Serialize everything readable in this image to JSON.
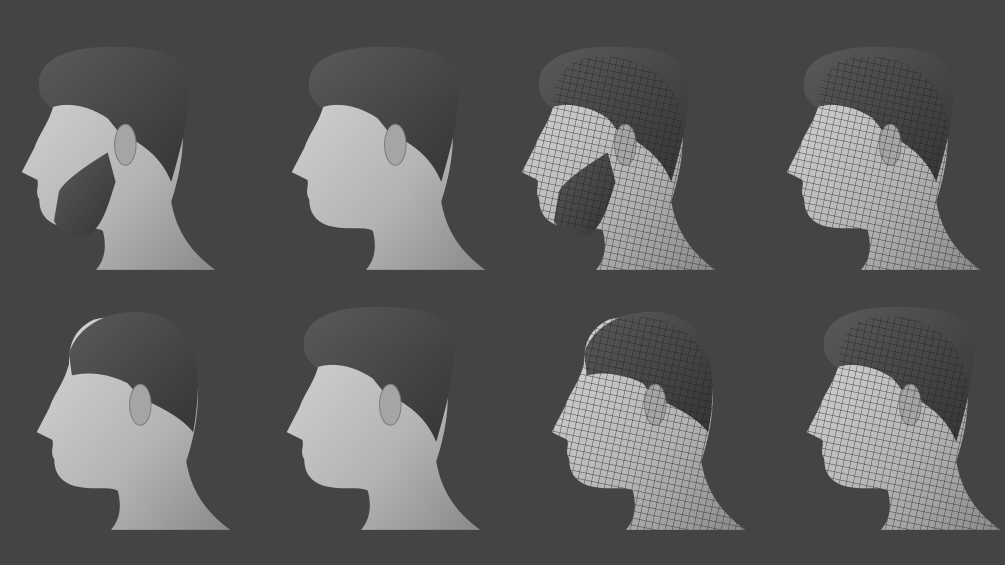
{
  "colors": {
    "background": "#444444",
    "skin": "#b9b9b9",
    "skin_shadow": "#8f8f8f",
    "hair": "#4a4a4a",
    "wire": "#1e1e1e"
  }
}
